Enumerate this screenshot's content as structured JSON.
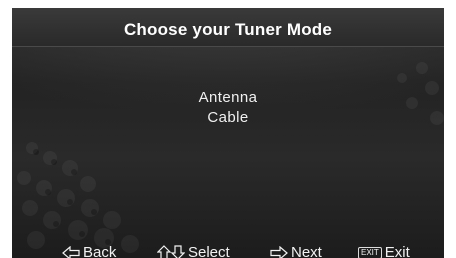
{
  "screen": {
    "title": "Choose your Tuner Mode"
  },
  "menu": {
    "items": [
      {
        "label": "Antenna"
      },
      {
        "label": "Cable"
      }
    ]
  },
  "footer": {
    "back": {
      "label": "Back",
      "icon": "arrow-left-icon"
    },
    "select": {
      "label": "Select",
      "icon": "arrow-up-down-icon"
    },
    "next": {
      "label": "Next",
      "icon": "arrow-right-icon"
    },
    "exit": {
      "label": "Exit",
      "key": "EXIT",
      "icon": "exit-key-icon"
    }
  },
  "colors": {
    "background": "#262626",
    "text": "#ffffff"
  }
}
